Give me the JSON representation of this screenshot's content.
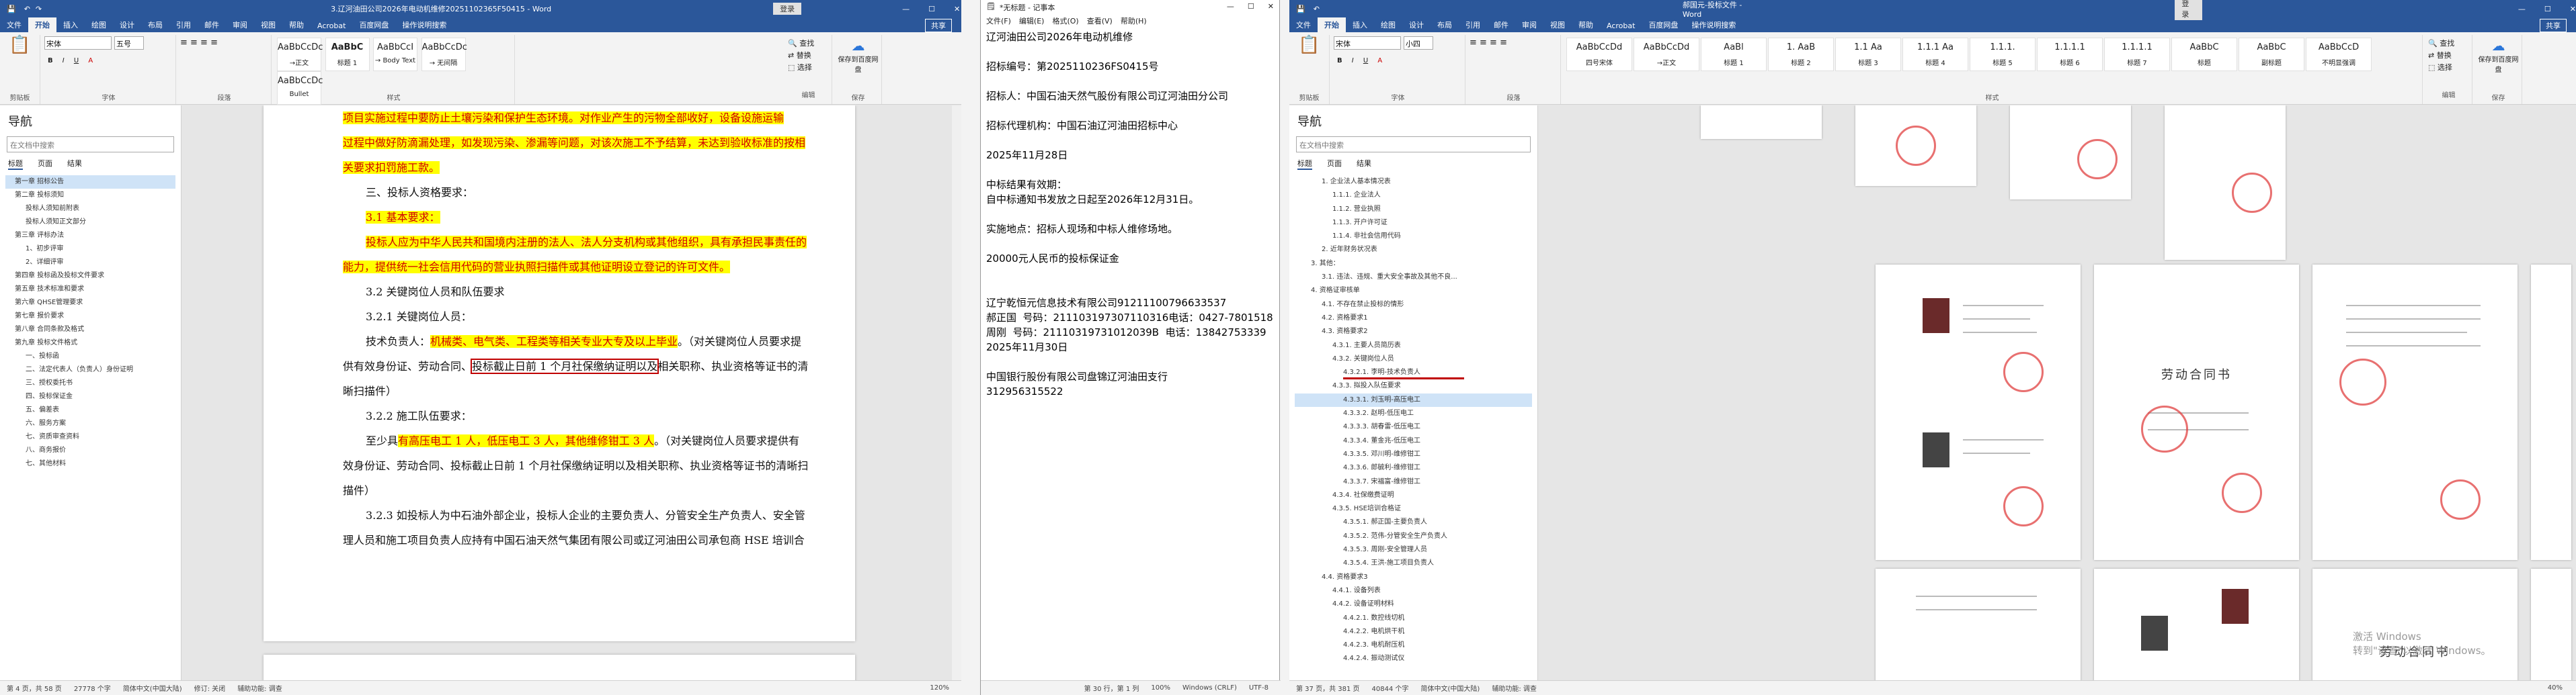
{
  "left_window": {
    "title": "3.辽河油田公司2026年电动机维修20251102365F50415 - Word",
    "title_btn": "登录",
    "tabs": [
      "文件",
      "开始",
      "插入",
      "绘图",
      "设计",
      "布局",
      "引用",
      "邮件",
      "审阅",
      "视图",
      "帮助",
      "Acrobat",
      "百度网盘",
      "操作说明搜索"
    ],
    "share": "共享",
    "font_name": "宋体",
    "font_size": "五号",
    "styles": [
      {
        "preview": "AaBbCcDc",
        "name": "→正文"
      },
      {
        "preview": "AaBbC",
        "name": "标题 1"
      },
      {
        "preview": "AaBbCcI",
        "name": "→ Body Text"
      },
      {
        "preview": "AaBbCcDc",
        "name": "→ 无间隔"
      },
      {
        "preview": "AaBbCcDc",
        "name": "Bullet"
      }
    ],
    "group_labels": [
      "剪贴板",
      "字体",
      "段落",
      "样式",
      "编辑",
      "保存",
      "发票查验"
    ],
    "edit_items": [
      "查找",
      "替换",
      "选择"
    ],
    "save_label": "保存到百度网盘",
    "nav_title": "导航",
    "nav_search_placeholder": "在文档中搜索",
    "nav_tabs": [
      "标题",
      "页面",
      "结果"
    ],
    "nav_items": [
      {
        "text": "第一章 招标公告",
        "sel": true
      },
      {
        "text": "第二章 投标须知",
        "sel": false
      },
      {
        "text": "投标人须知前附表",
        "sel": false
      },
      {
        "text": "投标人须知正文部分",
        "sel": false
      },
      {
        "text": "第三章 评标办法",
        "sel": false
      },
      {
        "text": "1、初步评审",
        "sel": false
      },
      {
        "text": "2、详细评审",
        "sel": false
      },
      {
        "text": "第四章 投标函及投标文件要求",
        "sel": false
      },
      {
        "text": "第五章 技术标准和要求",
        "sel": false
      },
      {
        "text": "第六章 QHSE管理要求",
        "sel": false
      },
      {
        "text": "第七章 报价要求",
        "sel": false
      },
      {
        "text": "第八章 合同条款及格式",
        "sel": false
      },
      {
        "text": "第九章 投标文件格式",
        "sel": false
      },
      {
        "text": "一、投标函",
        "sel": false
      },
      {
        "text": "二、法定代表人（负责人）身份证明",
        "sel": false
      },
      {
        "text": "三、授权委托书",
        "sel": false
      },
      {
        "text": "四、投标保证金",
        "sel": false
      },
      {
        "text": "五、偏差表",
        "sel": false
      },
      {
        "text": "六、服务方案",
        "sel": false
      },
      {
        "text": "七、资质审查资料",
        "sel": false
      },
      {
        "text": "八、商务报价",
        "sel": false
      },
      {
        "text": "七、其他材料",
        "sel": false
      }
    ],
    "doc": {
      "l1": "项目实施过程中要防止土壤污染和保护生态环境。对作业产生的污物全部收好，设备设施运输",
      "l2": "过程中做好防滴漏处理，如发现污染、渗漏等问题，对该次施工不予结算，未达到验收标准的按相",
      "l3": "关要求扣罚施工款。",
      "l4": "三、投标人资格要求：",
      "l5": "3.1 基本要求：",
      "l6": "投标人应为中华人民共和国境内注册的法人、法人分支机构或其他组织，具有承担民事责任的",
      "l7": "能力，提供统一社会信用代码的营业执照扫描件或其他证明设立登记的许可文件。",
      "l8": "3.2 关键岗位人员和队伍要求",
      "l9": "3.2.1 关键岗位人员：",
      "l10a": "技术负责人：",
      "l10b": "机械类、电气类、工程类等相关专业大专及以上毕业",
      "l10c": "。（对关键岗位人员要求提",
      "l11a": "供有效身份证、劳动合同、",
      "l11b": "投标截止日前 1 个月社保缴纳证明以及",
      "l11c": "相关职称、执业资格等证书的清",
      "l12": "晰扫描件）",
      "l13": "3.2.2 施工队伍要求：",
      "l14a": "至少具",
      "l14b": "有高压电工 1 人，低压电工 3 人，其他维修钳工 3 人",
      "l14c": "。（对关键岗位人员要求提供有",
      "l15": "效身份证、劳动合同、投标截止日前 1 个月社保缴纳证明以及相关职称、执业资格等证书的清晰扫",
      "l16": "描件）",
      "l17": "3.2.3 如投标人为中石油外部企业，投标人企业的主要负责人、分管安全生产负责人、安全管",
      "l18": "理人员和施工项目负责人应持有中国石油天然气集团有限公司或辽河油田公司承包商 HSE 培训合"
    },
    "status": {
      "page": "第 4 页，共 58 页",
      "words": "27778 个字",
      "lang": "简体中文(中国大陆)",
      "track": "修订: 关闭",
      "access": "辅助功能: 调查",
      "zoom": "120%"
    }
  },
  "notepad": {
    "title": "*无标题 - 记事本",
    "menus": [
      "文件(F)",
      "编辑(E)",
      "格式(O)",
      "查看(V)",
      "帮助(H)"
    ],
    "lines": [
      "辽河油田公司2026年电动机维修",
      "",
      "招标编号：第2025110236FS0415号",
      "",
      "招标人：中国石油天然气股份有限公司辽河油田分公司",
      "",
      "招标代理机构：中国石油辽河油田招标中心",
      "",
      "2025年11月28日",
      "",
      "中标结果有效期：",
      "自中标通知书发放之日起至2026年12月31日。",
      "",
      "实施地点：招标人现场和中标人维修场地。",
      "",
      "20000元人民币的投标保证金",
      "",
      "",
      "辽宁乾恒元信息技术有限公司91211100796633537",
      "郝正国  号码：211103197307110316电话：0427-7801518",
      "周刚  号码：21110319731012039B  电话：13842753339",
      "2025年11月30日",
      "",
      "中国银行股份有限公司盘锦辽河油田支行",
      "312956315522"
    ],
    "status": {
      "pos": "第 30 行，第 1 列",
      "zoom": "100%",
      "eol": "Windows (CRLF)",
      "enc": "UTF-8"
    }
  },
  "right_window": {
    "title": "郝国元-投标文件 - Word",
    "title_btn": "登录",
    "tabs": [
      "文件",
      "开始",
      "插入",
      "绘图",
      "设计",
      "布局",
      "引用",
      "邮件",
      "审阅",
      "视图",
      "帮助",
      "Acrobat",
      "百度网盘",
      "操作说明搜索"
    ],
    "share": "共享",
    "font_name": "宋体",
    "font_size": "小四",
    "styles": [
      {
        "preview": "AaBbCcDd",
        "name": "四号宋体"
      },
      {
        "preview": "AaBbCcDd",
        "name": "→正文"
      },
      {
        "preview": "AaBl",
        "name": "标题 1"
      },
      {
        "preview": "1. AaB",
        "name": "标题 2"
      },
      {
        "preview": "1.1 Aa",
        "name": "标题 3"
      },
      {
        "preview": "1.1.1 Aa",
        "name": "标题 4"
      },
      {
        "preview": "1.1.1.",
        "name": "标题 5"
      },
      {
        "preview": "1.1.1.1",
        "name": "标题 6"
      },
      {
        "preview": "1.1.1.1",
        "name": "标题 7"
      },
      {
        "preview": "AaBbC",
        "name": "标题"
      },
      {
        "preview": "AaBbC",
        "name": "副标题"
      },
      {
        "preview": "AaBbCcD",
        "name": "不明显强调"
      }
    ],
    "group_labels": [
      "剪贴板",
      "字体",
      "段落",
      "样式",
      "编辑",
      "保存",
      "发票查验"
    ],
    "edit_items": [
      "查找",
      "替换",
      "选择"
    ],
    "save_label": "保存到百度网盘",
    "nav_title": "导航",
    "nav_search_placeholder": "在文档中搜索",
    "nav_tabs": [
      "标题",
      "页面",
      "结果"
    ],
    "nav_items": [
      {
        "text": "1. 企业法人基本情况表",
        "sel": false,
        "lvl": 2
      },
      {
        "text": "1.1.1. 企业法人",
        "sel": false,
        "lvl": 3
      },
      {
        "text": "1.1.2. 营业执照",
        "sel": false,
        "lvl": 3
      },
      {
        "text": "1.1.3. 开户许可证",
        "sel": false,
        "lvl": 3
      },
      {
        "text": "1.1.4. 非社会信用代码",
        "sel": false,
        "lvl": 3
      },
      {
        "text": "2. 近年财务状况表",
        "sel": false,
        "lvl": 2
      },
      {
        "text": "3. 其他：",
        "sel": false,
        "lvl": 1
      },
      {
        "text": "3.1. 违法、违规、重大安全事故及其他不良...",
        "sel": false,
        "lvl": 2
      },
      {
        "text": "4. 资格证审核单",
        "sel": false,
        "lvl": 1
      },
      {
        "text": "4.1. 不存在禁止投标的情形",
        "sel": false,
        "lvl": 2
      },
      {
        "text": "4.2. 资格要求1",
        "sel": false,
        "lvl": 2
      },
      {
        "text": "4.3. 资格要求2",
        "sel": false,
        "lvl": 2
      },
      {
        "text": "4.3.1. 主要人员简历表",
        "sel": false,
        "lvl": 3
      },
      {
        "text": "4.3.2. 关键岗位人员",
        "sel": false,
        "lvl": 3
      },
      {
        "text": "4.3.2.1. 李明-技术负责人",
        "sel": false,
        "lvl": 4
      },
      {
        "text": "4.3.3. 拟投入队伍要求",
        "sel": false,
        "lvl": 3
      },
      {
        "text": "4.3.3.1. 刘玉明-高压电工",
        "sel": true,
        "lvl": 4
      },
      {
        "text": "4.3.3.2. 赵明-低压电工",
        "sel": false,
        "lvl": 4
      },
      {
        "text": "4.3.3.3. 胡春雷-低压电工",
        "sel": false,
        "lvl": 4
      },
      {
        "text": "4.3.3.4. 董金兆-低压电工",
        "sel": false,
        "lvl": 4
      },
      {
        "text": "4.3.3.5. 邓川明-维修钳工",
        "sel": false,
        "lvl": 4
      },
      {
        "text": "4.3.3.6. 郎毓利-维修钳工",
        "sel": false,
        "lvl": 4
      },
      {
        "text": "4.3.3.7. 宋福富-维修钳工",
        "sel": false,
        "lvl": 4
      },
      {
        "text": "4.3.4. 社保缴费证明",
        "sel": false,
        "lvl": 3
      },
      {
        "text": "4.3.5. HSE培训合格证",
        "sel": false,
        "lvl": 3
      },
      {
        "text": "4.3.5.1. 郝正国-主要负责人",
        "sel": false,
        "lvl": 4
      },
      {
        "text": "4.3.5.2. 范伟-分管安全生产负责人",
        "sel": false,
        "lvl": 4
      },
      {
        "text": "4.3.5.3. 周刚-安全管理人员",
        "sel": false,
        "lvl": 4
      },
      {
        "text": "4.3.5.4. 王洪-施工项目负责人",
        "sel": false,
        "lvl": 4
      },
      {
        "text": "4.4. 资格要求3",
        "sel": false,
        "lvl": 2
      },
      {
        "text": "4.4.1. 设备列表",
        "sel": false,
        "lvl": 3
      },
      {
        "text": "4.4.2. 设备证明材料",
        "sel": false,
        "lvl": 3
      },
      {
        "text": "4.4.2.1. 数控线切机",
        "sel": false,
        "lvl": 4
      },
      {
        "text": "4.4.2.2. 电机烘干机",
        "sel": false,
        "lvl": 4
      },
      {
        "text": "4.4.2.3. 电机耐压机",
        "sel": false,
        "lvl": 4
      },
      {
        "text": "4.4.2.4. 振动测试仪",
        "sel": false,
        "lvl": 4
      }
    ],
    "thumb_titles": [
      "劳动合同书",
      "劳动合同书"
    ],
    "watermark": "激活 Windows\n转到\"设置\"以激活 Windows。",
    "status": {
      "page": "第 37 页，共 381 页",
      "words": "40844 个字",
      "lang": "简体中文(中国大陆)",
      "access": "辅助功能: 调查",
      "zoom": "40%"
    }
  },
  "colors": {
    "word_blue": "#2b579a",
    "highlight": "#ffff00",
    "red_text": "#d00000",
    "stamp_red": "#e04040"
  }
}
